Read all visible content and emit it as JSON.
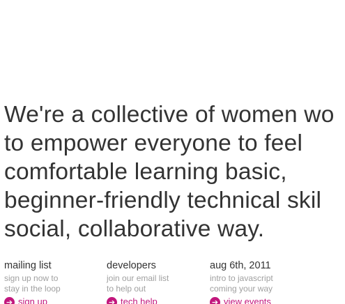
{
  "hero": {
    "lines": [
      "We're a collective of women wo",
      "to empower everyone to feel",
      "comfortable learning basic,",
      "beginner-friendly technical skil",
      "social, collaborative way."
    ]
  },
  "columns": [
    {
      "title": "mailing list",
      "desc_lines": [
        "sign up now to",
        "stay in the loop"
      ],
      "link_label": "sign up",
      "icon": "arrow-right-icon"
    },
    {
      "title": "developers",
      "desc_lines": [
        "join our email list",
        "to help out"
      ],
      "link_label": "tech help",
      "icon": "arrow-right-icon"
    },
    {
      "title": "aug 6th, 2011",
      "desc_lines": [
        "intro to javascript",
        "coming your way"
      ],
      "link_label": "view events",
      "icon": "arrow-right-icon"
    }
  ],
  "colors": {
    "text": "#333333",
    "muted": "#a0a0a0",
    "accent": "#c2177d",
    "background": "#ffffff"
  }
}
